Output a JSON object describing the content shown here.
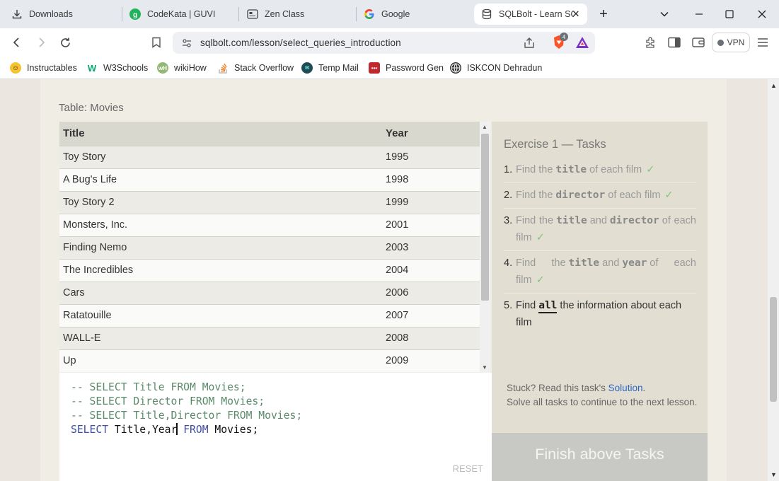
{
  "browser": {
    "tabs": [
      {
        "label": "Downloads",
        "icon": "download-icon"
      },
      {
        "label": "CodeKata | GUVI",
        "icon": "guvi-icon"
      },
      {
        "label": "Zen Class",
        "icon": "zen-class-icon"
      },
      {
        "label": "Google",
        "icon": "google-icon"
      },
      {
        "label": "SQLBolt - Learn SQ",
        "icon": "database-icon",
        "active": true
      }
    ],
    "new_tab": "+",
    "url": "sqlbolt.com/lesson/select_queries_introduction",
    "shield_count": "4",
    "vpn_label": "VPN",
    "bookmarks": [
      {
        "label": "Instructables",
        "icon": "instructables-icon"
      },
      {
        "label": "W3Schools",
        "icon": "w3schools-icon"
      },
      {
        "label": "wikiHow",
        "icon": "wikihow-icon"
      },
      {
        "label": "Stack Overflow",
        "icon": "stackoverflow-icon"
      },
      {
        "label": "Temp Mail",
        "icon": "tempmail-icon"
      },
      {
        "label": "Password Gen",
        "icon": "password-gen-icon"
      },
      {
        "label": "ISKCON Dehradun",
        "icon": "globe-icon"
      }
    ]
  },
  "lesson": {
    "table_caption": "Table: Movies",
    "columns": [
      "Title",
      "Year"
    ],
    "rows": [
      [
        "Toy Story",
        "1995"
      ],
      [
        "A Bug's Life",
        "1998"
      ],
      [
        "Toy Story 2",
        "1999"
      ],
      [
        "Monsters, Inc.",
        "2001"
      ],
      [
        "Finding Nemo",
        "2003"
      ],
      [
        "The Incredibles",
        "2004"
      ],
      [
        "Cars",
        "2006"
      ],
      [
        "Ratatouille",
        "2007"
      ],
      [
        "WALL-E",
        "2008"
      ],
      [
        "Up",
        "2009"
      ]
    ],
    "editor": {
      "comment_lines": [
        "-- SELECT Title FROM Movies;",
        "-- SELECT Director FROM Movies;",
        "-- SELECT Title,Director FROM Movies;"
      ],
      "query": {
        "select": "SELECT",
        "columns": "Title,Year",
        "from": "FROM",
        "table": "Movies;"
      },
      "reset_label": "RESET"
    },
    "exercise": {
      "title": "Exercise 1 — Tasks",
      "tasks": [
        {
          "num": "1.",
          "pre": "Find the",
          "code": "title",
          "post": "of each film",
          "done": true
        },
        {
          "num": "2.",
          "pre": "Find the",
          "code": "director",
          "post": "of each film",
          "done": true
        },
        {
          "num": "3.",
          "pre": "Find the",
          "code": "title",
          "mid": "and",
          "code2": "director",
          "post": "of each film",
          "done": true
        },
        {
          "num": "4.",
          "pre": "Find the",
          "code": "title",
          "mid": "and",
          "code2": "year",
          "post": "of each film",
          "done": true
        },
        {
          "num": "5.",
          "pre": "Find",
          "code": "all",
          "post": "the information about each film",
          "done": false
        }
      ],
      "check_mark": "✓",
      "stuck_prefix": "Stuck? Read this task's",
      "solution_link": "Solution",
      "stuck_suffix": ".",
      "continue_text": "Solve all tasks to continue to the next lesson.",
      "finish_label": "Finish above Tasks"
    }
  }
}
